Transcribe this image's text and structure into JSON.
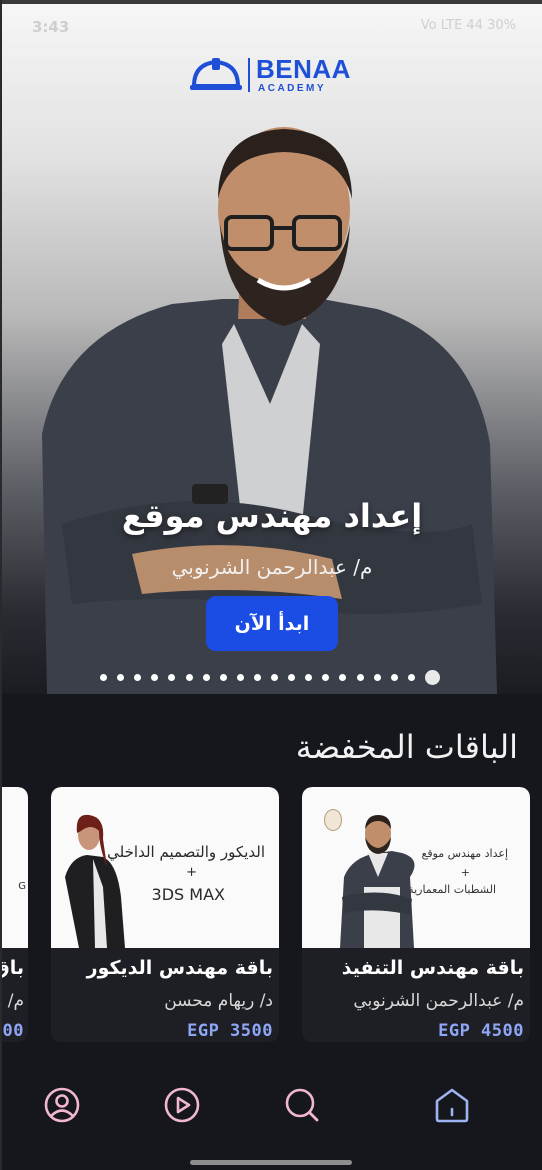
{
  "status_bar": {
    "time": "3:43",
    "right": "Vo LTE  44  30%"
  },
  "logo": {
    "title": "BENAA",
    "subtitle": "ACADEMY",
    "icon": "helmet-icon"
  },
  "hero": {
    "title": "إعداد مهندس موقع",
    "instructor": "م/ عبدالرحمن الشرنوبي",
    "cta_label": "ابدأ الآن",
    "slide_count": 20,
    "active_slide": 20
  },
  "section": {
    "title": "الباقات المخفضة"
  },
  "cards": [
    {
      "name": "باقة مهندس التنفيذ",
      "instructor": "م/ عبدالرحمن الشرنوبي",
      "price": "EGP 4500",
      "image_text_1": "إعداد مهندس موقع",
      "image_plus": "+",
      "image_text_2": "الشطبات المعمارية"
    },
    {
      "name": "باقة مهندس الديكور",
      "instructor": "د/ ريهام محسن",
      "price": "EGP 3500",
      "image_text_1": "الديكور والتصميم الداخلي",
      "image_plus": "+",
      "image_text_2": "3DS MAX"
    },
    {
      "name": "باق",
      "instructor": "م/",
      "price": "00",
      "image_text_1": "G"
    }
  ],
  "nav": {
    "items": [
      {
        "icon": "profile-icon"
      },
      {
        "icon": "play-icon"
      },
      {
        "icon": "search-icon"
      },
      {
        "icon": "home-icon"
      }
    ]
  },
  "colors": {
    "brand": "#1e4fd6",
    "cta": "#1b4de4",
    "price": "#8ea6f5",
    "nav_icon": "#f0b7cf",
    "background": "#16171d"
  }
}
